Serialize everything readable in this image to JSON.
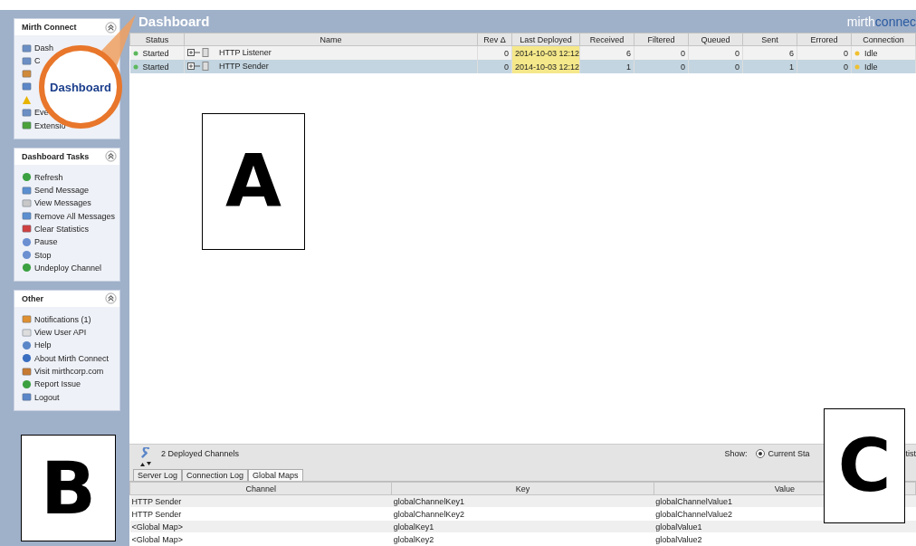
{
  "sidebar": {
    "panels": [
      {
        "title": "Mirth Connect",
        "items": [
          {
            "kind": "link",
            "label": "Dash"
          },
          {
            "kind": "link",
            "label": "C"
          },
          {
            "kind": "icon"
          },
          {
            "kind": "icon"
          },
          {
            "kind": "icon"
          },
          {
            "kind": "link",
            "label": "Eve"
          },
          {
            "kind": "link",
            "label": "Extensio"
          }
        ]
      },
      {
        "title": "Dashboard Tasks",
        "items": [
          {
            "label": "Refresh"
          },
          {
            "label": "Send Message"
          },
          {
            "label": "View Messages"
          },
          {
            "label": "Remove All Messages"
          },
          {
            "label": "Clear Statistics"
          },
          {
            "label": "Pause"
          },
          {
            "label": "Stop"
          },
          {
            "label": "Undeploy Channel"
          }
        ]
      },
      {
        "title": "Other",
        "items": [
          {
            "label": "Notifications (1)"
          },
          {
            "label": "View User API"
          },
          {
            "label": "Help"
          },
          {
            "label": "About Mirth Connect"
          },
          {
            "label": "Visit mirthcorp.com"
          },
          {
            "label": "Report Issue"
          },
          {
            "label": "Logout"
          }
        ]
      }
    ]
  },
  "header": {
    "title": "Dashboard",
    "logo": [
      "mirth",
      "connec"
    ]
  },
  "channels": {
    "columns": [
      "Status",
      "Name",
      "Rev Δ",
      "Last Deployed",
      "Received",
      "Filtered",
      "Queued",
      "Sent",
      "Errored",
      "Connection"
    ],
    "rows": [
      {
        "status": "Started",
        "name": "HTTP Listener",
        "rev": "0",
        "deployed": "2014-10-03 12:12",
        "received": "6",
        "filtered": "0",
        "queued": "0",
        "sent": "6",
        "errored": "0",
        "connection": "Idle",
        "selected": false
      },
      {
        "status": "Started",
        "name": "HTTP Sender",
        "rev": "0",
        "deployed": "2014-10-03 12:12",
        "received": "1",
        "filtered": "0",
        "queued": "0",
        "sent": "1",
        "errored": "0",
        "connection": "Idle",
        "selected": true
      }
    ]
  },
  "status_bar": {
    "text": "2 Deployed Channels",
    "show_label": "Show:",
    "radio": {
      "label": "Current Sta",
      "selected": true
    },
    "trailing": "tist"
  },
  "log_tabs": [
    {
      "label": "Server Log",
      "selected": false
    },
    {
      "label": "Connection Log",
      "selected": false
    },
    {
      "label": "Global Maps",
      "selected": true
    }
  ],
  "global_maps": {
    "columns": [
      "Channel",
      "Key",
      "Value"
    ],
    "rows": [
      [
        "HTTP Sender",
        "globalChannelKey1",
        "globalChannelValue1"
      ],
      [
        "HTTP Sender",
        "globalChannelKey2",
        "globalChannelValue2"
      ],
      [
        "<Global Map>",
        "globalKey1",
        "globalValue1"
      ],
      [
        "<Global Map>",
        "globalKey2",
        "globalValue2"
      ]
    ]
  },
  "callout": {
    "label": "Dashboard"
  },
  "annotations": [
    "A",
    "B",
    "C"
  ]
}
